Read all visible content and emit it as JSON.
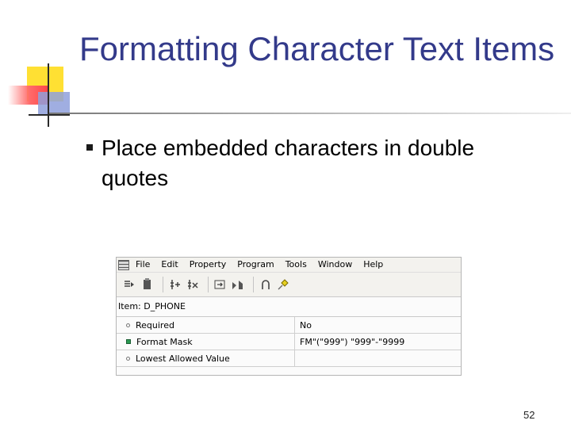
{
  "slide": {
    "title": "Formatting Character Text Items",
    "bullet": "Place embedded characters in double quotes",
    "page_number": "52"
  },
  "screenshot": {
    "menu": [
      "File",
      "Edit",
      "Property",
      "Program",
      "Tools",
      "Window",
      "Help"
    ],
    "toolbar_icons": [
      "copy-icon",
      "paste-icon",
      "add-property-icon",
      "delete-property-icon",
      "inherit-icon",
      "lock-icon",
      "union-icon",
      "pin-icon"
    ],
    "item_label": "Item: D_PHONE",
    "properties": [
      {
        "name": "Required",
        "value": "No",
        "marker": "dot"
      },
      {
        "name": "Format Mask",
        "value": "FM\"(\"999\") \"999\"-\"9999",
        "marker": "square"
      },
      {
        "name": "Lowest Allowed Value",
        "value": "",
        "marker": "dot"
      }
    ]
  },
  "colors": {
    "title": "#333a8a",
    "decor_yellow": "#ffe033",
    "decor_red": "#ff4848",
    "decor_blue": "#8fa0dc",
    "marker_green": "#2c9a52"
  }
}
